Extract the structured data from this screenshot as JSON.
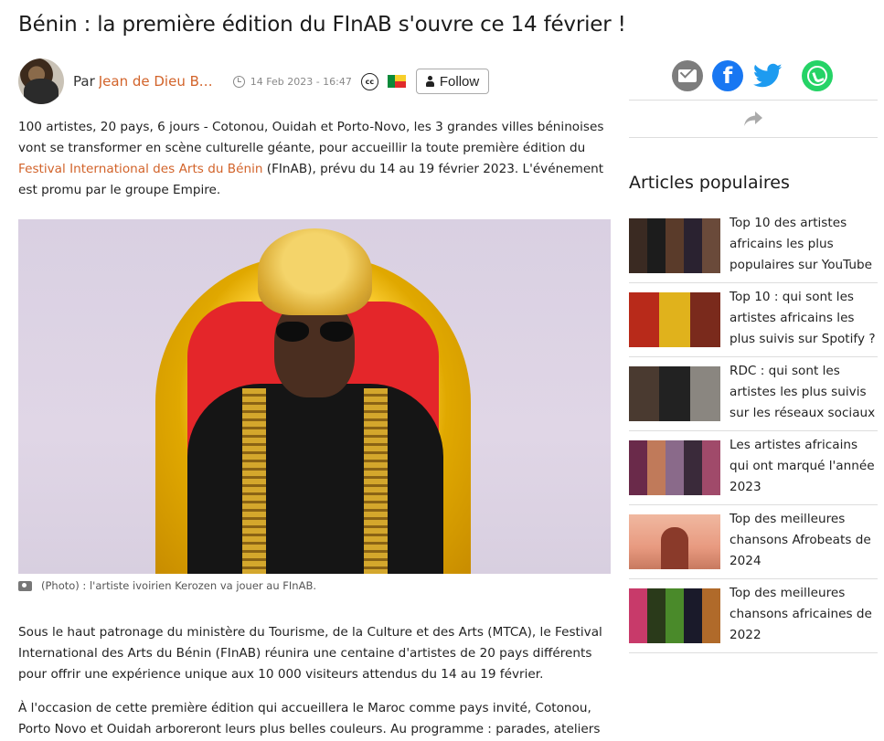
{
  "article": {
    "title": "Bénin : la première édition du FInAB s'ouvre ce 14 février !",
    "byline_prefix": "Par",
    "author": "Jean de Dieu BO...",
    "date": "14 Feb 2023 - 16:47",
    "license_badge": "cc",
    "follow_label": "Follow",
    "intro_before_link": "100 artistes, 20 pays, 6 jours - Cotonou, Ouidah et Porto-Novo, les 3 grandes villes béninoises vont se transformer en scène culturelle géante, pour accueillir la toute première édition du ",
    "intro_link": "Festival International des Arts du Bénin",
    "intro_after_link": " (FInAB), prévu du 14 au 19 février 2023. L'événement est promu par le groupe Empire.",
    "photo_caption": "(Photo) : l'artiste ivoirien Kerozen va jouer au FInAB.",
    "paragraph_1": "Sous le haut patronage du ministère du Tourisme, de la Culture et des Arts (MTCA), le Festival International des Arts du Bénin (FInAB) réunira une centaine d'artistes de 20 pays différents pour offrir une expérience unique aux 10 000 visiteurs attendus du 14 au 19 février.",
    "paragraph_2": "À l'occasion de cette première édition qui accueillera le Maroc comme pays invité, Cotonou, Porto Novo et Ouidah arboreront leurs plus belles couleurs. Au programme : parades, ateliers"
  },
  "icons": {
    "clock": "clock-icon",
    "camera": "camera-icon",
    "user": "user-icon",
    "email": "email-icon",
    "facebook": "facebook-icon",
    "twitter": "twitter-icon",
    "whatsapp": "whatsapp-icon",
    "share": "share-arrow-icon"
  },
  "colors": {
    "link": "#d2632a",
    "facebook": "#1877f2",
    "twitter": "#1d9bf0",
    "whatsapp": "#25d366",
    "email": "#7d7d7d"
  },
  "sidebar": {
    "popular_title": "Articles populaires",
    "items": [
      {
        "label": "Top 10 des artistes africains les plus populaires sur YouTube"
      },
      {
        "label": "Top 10 : qui sont les artistes africains les plus suivis sur Spotify ?"
      },
      {
        "label": "RDC : qui sont les artistes les plus suivis sur les réseaux sociaux"
      },
      {
        "label": "Les artistes africains qui ont marqué l'année 2023"
      },
      {
        "label": "Top des meilleures chansons Afrobeats de 2024"
      },
      {
        "label": "Top des meilleures chansons africaines de 2022"
      }
    ]
  }
}
